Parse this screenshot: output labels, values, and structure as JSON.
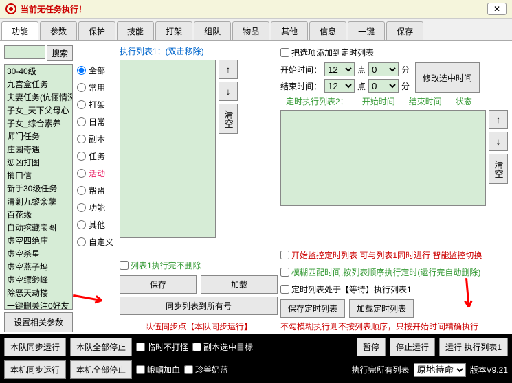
{
  "titlebar": {
    "title": "当前无任务执行！",
    "close": "✕"
  },
  "tabs": [
    "功能",
    "参数",
    "保护",
    "技能",
    "打架",
    "组队",
    "物品",
    "其他",
    "信息",
    "一键",
    "保存"
  ],
  "search": {
    "btn": "搜索"
  },
  "tasklist": [
    "30-40级",
    "九宫盒任务",
    "夫妻任务(伉俪情深)",
    "子女_天下父母心",
    "子女_综合素养",
    "师门任务",
    "庄园奇遇",
    "惩凶打图",
    "捎口信",
    "新手30级任务",
    "清剿九黎余孽",
    "百花缘",
    "自动挖藏宝图",
    "虚空四绝庄",
    "虚空杀星",
    "虚空燕子坞",
    "虚空缥缈峰",
    "除恶天劫楼",
    "一键删关注0好友"
  ],
  "radios": [
    "全部",
    "常用",
    "打架",
    "日常",
    "副本",
    "任务",
    "活动",
    "帮盟",
    "功能",
    "其他",
    "自定义"
  ],
  "col3": {
    "label": "执行列表1：(双击移除)",
    "up": "↑",
    "down": "↓",
    "clear": "清空",
    "chk1": "列表1执行完不删除",
    "save": "保存",
    "load": "加载",
    "sync": "同步列表到所有号",
    "teamline": "队伍同步点【本队同步运行】"
  },
  "col4": {
    "addchk": "把选项添加到定时列表",
    "start_lbl": "开始时间：",
    "end_lbl": "结束时间：",
    "h1": "12",
    "m1": "0",
    "h2": "12",
    "m2": "0",
    "dot": "点",
    "min": "分",
    "modbtn": "修改选中时间",
    "timed_lbl": "定时执行列表2：",
    "hdr1": "开始时间",
    "hdr2": "结束时间",
    "hdr3": "状态",
    "up": "↑",
    "down": "↓",
    "clear": "清空",
    "chk_monitor": "开始监控定时列表 可与列表1同时进行 智能监控切换",
    "chk_fuzzy": "模糊匹配时间,按列表顺序执行定时(运行完自动删除)",
    "chk_wait": "定时列表处于【等待】执行列表1",
    "save": "保存定时列表",
    "load": "加载定时列表",
    "warn": "不勾模糊执行则不按列表顺序，只按开始时间精确执行"
  },
  "footer": {
    "b1": "本队同步运行",
    "b2": "本队全部停止",
    "b3": "本机同步运行",
    "b4": "本机全部停止",
    "c1": "临时不打怪",
    "c2": "副本选中目标",
    "c3": "峨嵋加血",
    "c4": "珍兽奶蓝",
    "pause": "暂停",
    "stop": "停止运行",
    "run": "运行 执行列表1",
    "done_lbl": "执行完所有列表",
    "done_opt": "原地待命",
    "ver": "版本V9.21"
  },
  "setparams": "设置相关参数"
}
